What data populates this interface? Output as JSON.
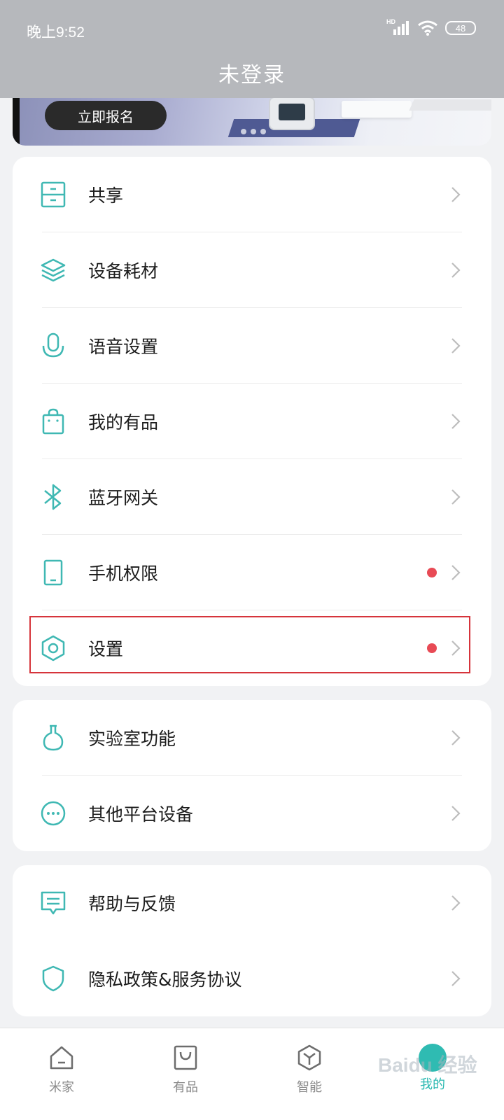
{
  "status_bar": {
    "time": "晚上9:52",
    "network": "HD",
    "battery": "48"
  },
  "header": {
    "title": "未登录"
  },
  "banner": {
    "button_label": "立即报名"
  },
  "group1": [
    {
      "label": "共享",
      "icon": "drawer-icon",
      "dot": false
    },
    {
      "label": "设备耗材",
      "icon": "layers-icon",
      "dot": false
    },
    {
      "label": "语音设置",
      "icon": "microphone-icon",
      "dot": false
    },
    {
      "label": "我的有品",
      "icon": "shopping-bag-icon",
      "dot": false
    },
    {
      "label": "蓝牙网关",
      "icon": "bluetooth-icon",
      "dot": false
    },
    {
      "label": "手机权限",
      "icon": "phone-icon",
      "dot": true
    },
    {
      "label": "设置",
      "icon": "settings-hexagon-icon",
      "dot": true
    }
  ],
  "group2": [
    {
      "label": "实验室功能",
      "icon": "flask-icon",
      "dot": false
    },
    {
      "label": "其他平台设备",
      "icon": "more-dots-icon",
      "dot": false
    }
  ],
  "group3": [
    {
      "label": "帮助与反馈",
      "icon": "feedback-icon",
      "dot": false
    },
    {
      "label": "隐私政策&服务协议",
      "icon": "shield-icon",
      "dot": false
    }
  ],
  "bottom_nav": [
    {
      "label": "米家",
      "icon": "home-icon",
      "active": false
    },
    {
      "label": "有品",
      "icon": "bag-icon",
      "active": false
    },
    {
      "label": "智能",
      "icon": "smart-cube-icon",
      "active": false
    },
    {
      "label": "我的",
      "icon": "profile-icon",
      "active": true
    }
  ],
  "colors": {
    "accent": "#2fbbb2",
    "icon_teal": "#3fb8b3",
    "red_dot": "#e84a55",
    "highlight_border": "#d6343b",
    "header_bg": "#b6b8bc"
  },
  "watermark": "Baidu 经验"
}
